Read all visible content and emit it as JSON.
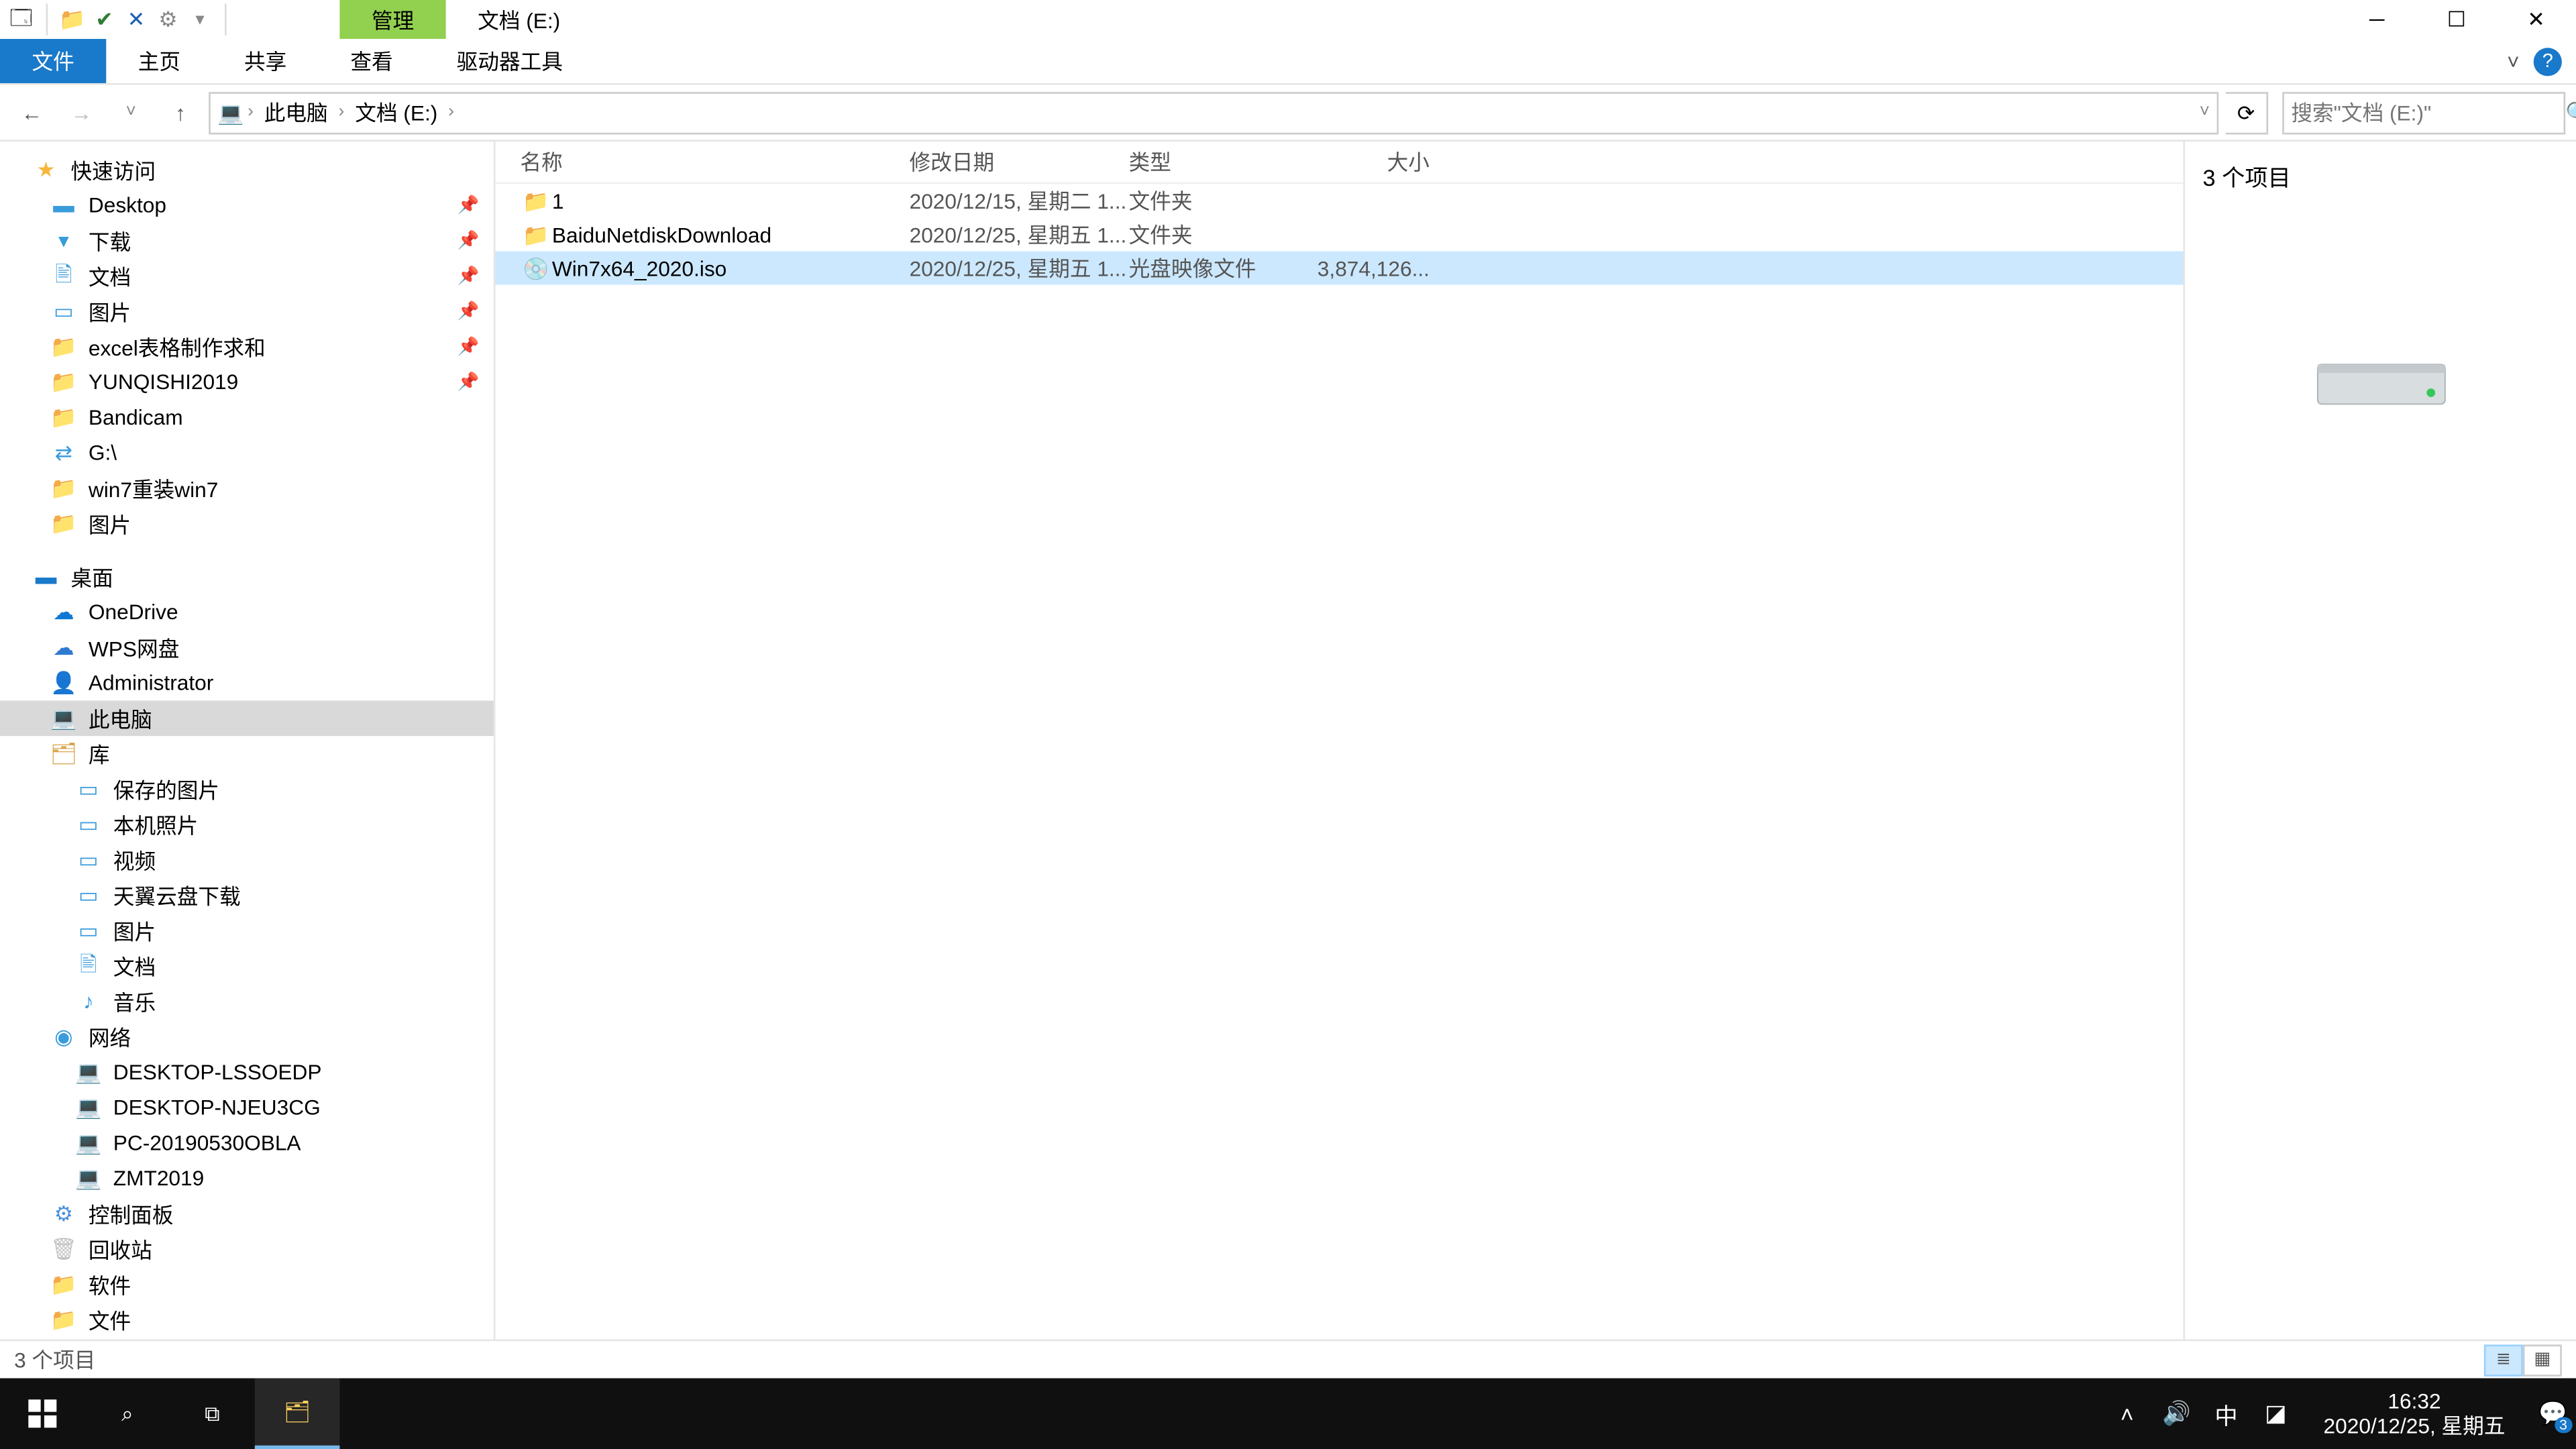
{
  "titlebar": {
    "context_tab": "管理",
    "title": "文档 (E:)"
  },
  "ribbon": {
    "file": "文件",
    "tabs": [
      "主页",
      "共享",
      "查看",
      "驱动器工具"
    ],
    "expand_hint": "˅",
    "help": "?"
  },
  "address": {
    "back": "←",
    "forward": "→",
    "up": "↑",
    "crumbs": [
      "此电脑",
      "文档 (E:)"
    ],
    "refresh": "⟳",
    "search_placeholder": "搜索\"文档 (E:)\""
  },
  "nav": {
    "quick_access": {
      "label": "快速访问",
      "icon": "★",
      "color": "#f6b73c"
    },
    "quick_items": [
      {
        "label": "Desktop",
        "icon": "▬",
        "color": "#3a9bdc",
        "pinned": true
      },
      {
        "label": "下载",
        "icon": "▾",
        "color": "#3a9bdc",
        "pinned": true
      },
      {
        "label": "文档",
        "icon": "🖹",
        "color": "#3a9bdc",
        "pinned": true
      },
      {
        "label": "图片",
        "icon": "▭",
        "color": "#3a9bdc",
        "pinned": true
      },
      {
        "label": "excel表格制作求和",
        "icon": "📁",
        "color": "#ffd35a",
        "pinned": true
      },
      {
        "label": "YUNQISHI2019",
        "icon": "📁",
        "color": "#ffd35a",
        "pinned": true
      },
      {
        "label": "Bandicam",
        "icon": "📁",
        "color": "#ffd35a",
        "pinned": false
      },
      {
        "label": "G:\\",
        "icon": "⇄",
        "color": "#3a9bdc",
        "pinned": false
      },
      {
        "label": "win7重装win7",
        "icon": "📁",
        "color": "#ffd35a",
        "pinned": false
      },
      {
        "label": "图片",
        "icon": "📁",
        "color": "#ffd35a",
        "pinned": false
      }
    ],
    "desktop_root": {
      "label": "桌面",
      "icon": "▬",
      "color": "#1979ca"
    },
    "desktop_items": [
      {
        "label": "OneDrive",
        "icon": "☁",
        "color": "#0f78d4"
      },
      {
        "label": "WPS网盘",
        "icon": "☁",
        "color": "#2e7ad1"
      },
      {
        "label": "Administrator",
        "icon": "👤",
        "color": "#caa472"
      },
      {
        "label": "此电脑",
        "icon": "💻",
        "color": "#1979ca",
        "selected": true
      },
      {
        "label": "库",
        "icon": "🗂",
        "color": "#d9a34a"
      }
    ],
    "library_items": [
      {
        "label": "保存的图片",
        "icon": "▭",
        "color": "#3a9bdc"
      },
      {
        "label": "本机照片",
        "icon": "▭",
        "color": "#3a9bdc"
      },
      {
        "label": "视频",
        "icon": "▭",
        "color": "#3a9bdc"
      },
      {
        "label": "天翼云盘下载",
        "icon": "▭",
        "color": "#3a9bdc"
      },
      {
        "label": "图片",
        "icon": "▭",
        "color": "#3a9bdc"
      },
      {
        "label": "文档",
        "icon": "🖹",
        "color": "#3a9bdc"
      },
      {
        "label": "音乐",
        "icon": "♪",
        "color": "#3a9bdc"
      }
    ],
    "network": {
      "label": "网络",
      "icon": "◉",
      "color": "#3a9bdc"
    },
    "network_items": [
      {
        "label": "DESKTOP-LSSOEDP",
        "icon": "💻",
        "color": "#3a9bdc"
      },
      {
        "label": "DESKTOP-NJEU3CG",
        "icon": "💻",
        "color": "#3a9bdc"
      },
      {
        "label": "PC-20190530OBLA",
        "icon": "💻",
        "color": "#3a9bdc"
      },
      {
        "label": "ZMT2019",
        "icon": "💻",
        "color": "#3a9bdc"
      }
    ],
    "misc_items": [
      {
        "label": "控制面板",
        "icon": "⚙",
        "color": "#4a90d9"
      },
      {
        "label": "回收站",
        "icon": "🗑",
        "color": "#bfbfbf"
      },
      {
        "label": "软件",
        "icon": "📁",
        "color": "#ffd35a"
      },
      {
        "label": "文件",
        "icon": "📁",
        "color": "#ffd35a"
      }
    ]
  },
  "columns": {
    "name": "名称",
    "date": "修改日期",
    "type": "类型",
    "size": "大小",
    "sort_indicator": "ˆ"
  },
  "files": [
    {
      "icon": "📁",
      "name": "1",
      "date": "2020/12/15, 星期二 1...",
      "type": "文件夹",
      "size": "",
      "selected": false,
      "isfolder": true
    },
    {
      "icon": "📁",
      "name": "BaiduNetdiskDownload",
      "date": "2020/12/25, 星期五 1...",
      "type": "文件夹",
      "size": "",
      "selected": false,
      "isfolder": true
    },
    {
      "icon": "💿",
      "name": "Win7x64_2020.iso",
      "date": "2020/12/25, 星期五 1...",
      "type": "光盘映像文件",
      "size": "3,874,126...",
      "selected": true,
      "isfolder": false
    }
  ],
  "preview": {
    "item_count": "3 个项目"
  },
  "statusbar": {
    "text": "3 个项目"
  },
  "taskbar": {
    "time": "16:32",
    "date": "2020/12/25, 星期五",
    "ime": "中",
    "notif_badge": "3"
  }
}
